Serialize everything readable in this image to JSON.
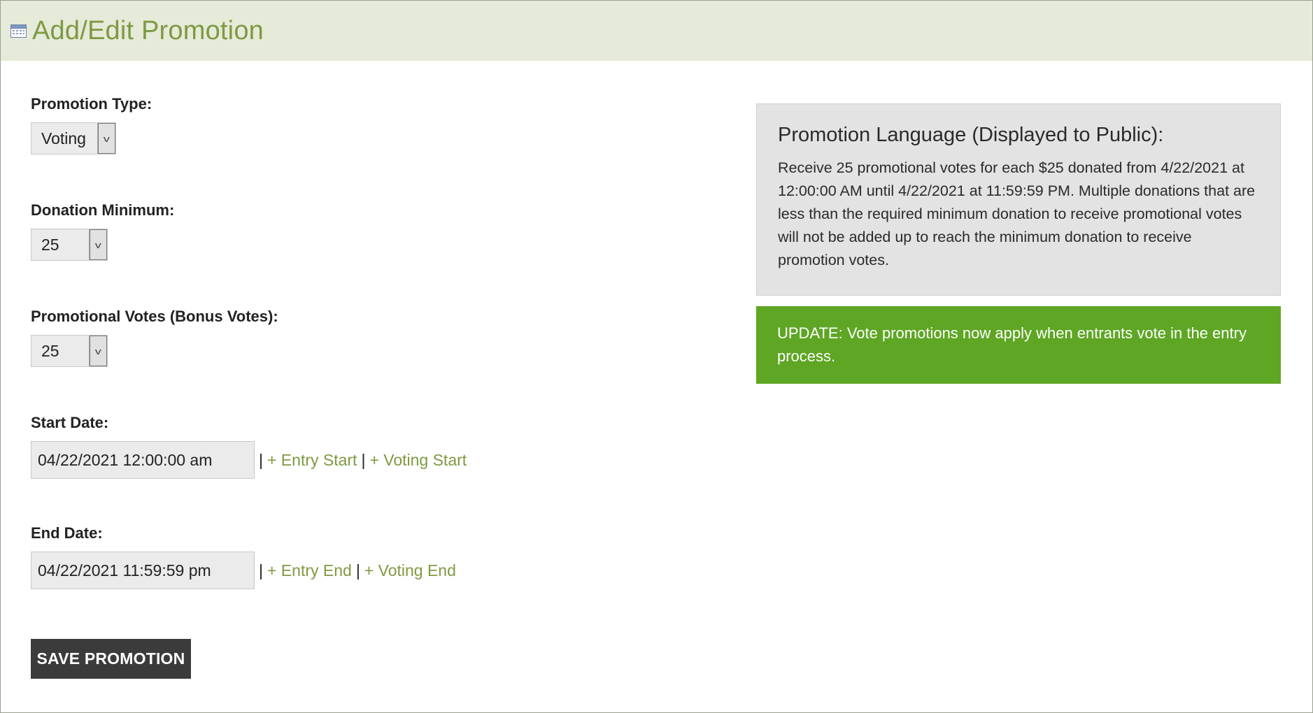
{
  "header": {
    "icon": "calendar-icon",
    "title": "Add/Edit Promotion"
  },
  "form": {
    "promotion_type": {
      "label": "Promotion Type:",
      "value": "Voting"
    },
    "donation_minimum": {
      "label": "Donation Minimum:",
      "value": "25"
    },
    "promotional_votes": {
      "label": "Promotional Votes (Bonus Votes):",
      "value": "25"
    },
    "start_date": {
      "label": "Start Date:",
      "value": "04/22/2021 12:00:00 am",
      "sep1": "|",
      "link1": "+ Entry Start",
      "sep2": "|",
      "link2": "+ Voting Start"
    },
    "end_date": {
      "label": "End Date:",
      "value": "04/22/2021 11:59:59 pm",
      "sep1": "|",
      "link1": "+ Entry End",
      "sep2": "|",
      "link2": "+ Voting End"
    },
    "save_label": "SAVE PROMOTION"
  },
  "promotion_language": {
    "title": "Promotion Language (Displayed to Public):",
    "text": "Receive 25 promotional votes for each $25 donated from 4/22/2021 at 12:00:00 AM until 4/22/2021 at 11:59:59 PM. Multiple donations that are less than the required minimum donation to receive promotional votes will not be added up to reach the minimum donation to receive promotion votes."
  },
  "update_notice": {
    "text": "UPDATE: Vote promotions now apply when entrants vote in the entry process."
  },
  "colors": {
    "header_bg": "#e6ead8",
    "accent_green": "#7d9a42",
    "notice_green": "#5ea624",
    "button_dark": "#3b3b3b"
  }
}
